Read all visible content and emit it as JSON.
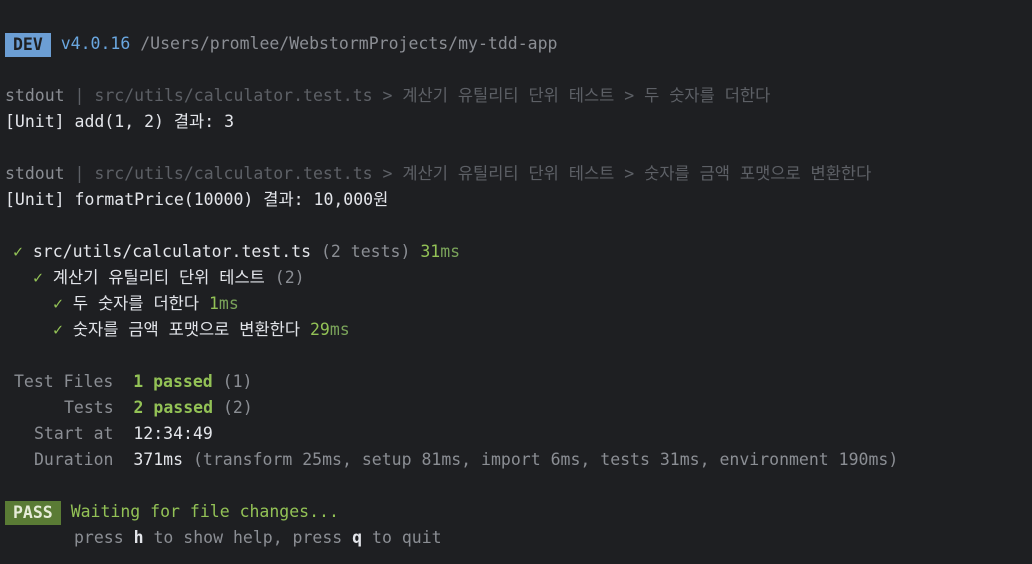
{
  "header": {
    "mode_badge": "DEV",
    "version": "v4.0.16",
    "path": "/Users/promlee/WebstormProjects/my-tdd-app"
  },
  "logs": [
    {
      "prefix": "stdout",
      "separator": "|",
      "source": "src/utils/calculator.test.ts > 계산기 유틸리티 단위 테스트 > 두 숫자를 더한다",
      "message": "[Unit] add(1, 2) 결과: 3"
    },
    {
      "prefix": "stdout",
      "separator": "|",
      "source": "src/utils/calculator.test.ts > 계산기 유틸리티 단위 테스트 > 숫자를 금액 포맷으로 변환한다",
      "message": "[Unit] formatPrice(10000) 결과: 10,000원"
    }
  ],
  "results": {
    "file": {
      "check": "✓",
      "name": "src/utils/calculator.test.ts",
      "count": "(2 tests)",
      "time_value": "31",
      "time_unit": "ms"
    },
    "suite": {
      "check": "✓",
      "name": "계산기 유틸리티 단위 테스트",
      "count": "(2)"
    },
    "tests": [
      {
        "check": "✓",
        "name": "두 숫자를 더한다",
        "time_value": "1",
        "time_unit": "ms"
      },
      {
        "check": "✓",
        "name": "숫자를 금액 포맷으로 변환한다",
        "time_value": "29",
        "time_unit": "ms"
      }
    ]
  },
  "summary": {
    "test_files_label": "Test Files",
    "test_files_passed": "1 passed",
    "test_files_total": "(1)",
    "tests_label": "Tests",
    "tests_passed": "2 passed",
    "tests_total": "(2)",
    "start_label": "Start at",
    "start_value": "12:34:49",
    "duration_label": "Duration",
    "duration_value": "371ms",
    "duration_detail": "(transform 25ms, setup 81ms, import 6ms, tests 31ms, environment 190ms)"
  },
  "footer": {
    "status_badge": "PASS",
    "status_message": "Waiting for file changes...",
    "help_press_1": "press",
    "help_key_1": "h",
    "help_text_1": "to show help, press",
    "help_key_2": "q",
    "help_text_2": "to quit"
  },
  "colors": {
    "background": "#1e1f22",
    "dev_badge": "#6c9ed4",
    "pass_badge": "#5a7b35",
    "success": "#93c256"
  }
}
